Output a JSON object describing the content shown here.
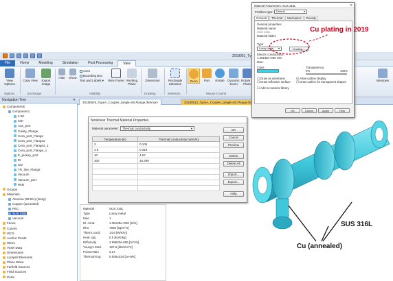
{
  "app": {
    "title": "2018051_TypeA..."
  },
  "ribbon_tabs": [
    "File",
    "Home",
    "Modeling",
    "Simulation",
    "Post Processing",
    "View"
  ],
  "ribbon": {
    "view_options": "View Options",
    "copy_view": "Copy View",
    "export_image": "Export Image",
    "hide": "Hide",
    "show": "Show",
    "axes": "Axes",
    "bounding_box": "Bounding Box",
    "text_labels": "Text and Labels",
    "wire_frame": "Wire Frame",
    "working_plane": "Working Plane",
    "dimension": "Dimension",
    "rectangle_selection": "Rectangle Selection",
    "zoom": "Zoom",
    "pan": "Pan",
    "rotate": "Rotate",
    "dynamic_zoom": "Dynamic Zoom",
    "rotate_in_plane": "Rotate in Plane",
    "windows": "Windows",
    "groups": [
      "Options",
      "Exchange",
      "Visibility",
      "Drawing",
      "Selection",
      "Mouse Control"
    ]
  },
  "nav": {
    "title": "Navigation Tree",
    "items": [
      "Components",
      "component1",
      "4.5K",
      "40K",
      "Aux_port",
      "Cavity_Flange",
      "Cera_port_Flange",
      "Cera_port_Flange2",
      "Cera_port_Flange2_1",
      "Cera_port_Flange_1",
      "E_pickup_port",
      "ID",
      "OD",
      "TR_line_Flange",
      "Vacuum",
      "Vacuum_port",
      "WIN",
      "Groups",
      "Materials",
      "Alumina (99.5%) (lossy)",
      "Copper (annealed)",
      "PEC",
      "SUS 316L",
      "Vacuum",
      "Faces",
      "Curves",
      "WCS",
      "Anchor Points",
      "Wires",
      "Voxel Data",
      "Dimensions",
      "Lumped Elements",
      "Plane Wave",
      "Farfield Sources",
      "Field Sources",
      "Ports"
    ]
  },
  "doc_tabs": [
    "20180629_TypeA_Coupler_(angle=60,Flange,thermal>",
    "20180513_TypeA_Coupler_(angle=60,Flange,thermal>"
  ],
  "nonlinear_dialog": {
    "title": "Nonlinear Thermal Material Properties",
    "param_label": "Material parameter:",
    "param_value": "Thermal conductivity",
    "col1": "Temperature [K]",
    "col2": "Thermal conductivity [W/m/K]",
    "rows": [
      [
        "2",
        "0.105"
      ],
      [
        "4.5",
        "0.319"
      ],
      [
        "40",
        "4.67"
      ],
      [
        "300",
        "15.309"
      ]
    ],
    "buttons": [
      "OK",
      "Cancel",
      "Preview",
      "Delete",
      "Delete All",
      "Import...",
      "Export...",
      "Help"
    ]
  },
  "props": {
    "rows": [
      [
        "Material",
        "SUS 316L"
      ],
      [
        "Type",
        "Lossy metal"
      ],
      [
        "Mue",
        "1"
      ],
      [
        "El. cond.",
        "1.35135e+006 [S/m]"
      ],
      [
        "Rho",
        "7900 [kg/m^3]"
      ],
      [
        "Therm.cond.",
        "14.6 [W/K/m]"
      ],
      [
        "Heat cap.",
        "0.5 [kJ/K/kg]"
      ],
      [
        "Diffusivity",
        "3.69620e-006 [m^2/s]"
      ],
      [
        "Young's Mod.",
        "197.5 [kN/mm^2]"
      ],
      [
        "Poiss.Ratio",
        "0.27"
      ],
      [
        "Thermal Exp.",
        "0.0064234 [1e-6/K]"
      ]
    ]
  },
  "mat_dialog": {
    "title": "Material Parameters: SUS 316L",
    "problem_type_label": "Problem type:",
    "problem_type": "Default",
    "tabs": [
      "General",
      "Thermal",
      "Mechanics",
      "Density"
    ],
    "general_props": "General properties",
    "material_name_label": "Material name:",
    "material_name": "SUS 316L",
    "material_folder_label": "Material folder:",
    "type_label": "Type:",
    "type_value": "Lossy metal",
    "coating_btn": "Coating...",
    "el_cond_label": "Electric conductivity:",
    "el_cond_value": "1.35135e+006",
    "el_cond_unit": "S/m",
    "mue_label": "Mue:",
    "color_label": "Color:",
    "transparency_label": "Transparency:",
    "t0": "0%",
    "t100": "100%",
    "chk_draw_wireframe": "Draw as wireframe",
    "chk_reflective": "Draw reflective surface",
    "chk_outline": "Allow outline display",
    "chk_transparent": "Draw outline for transparent shapes",
    "chk_favorites": "Add to material library",
    "buttons": [
      "OK",
      "Cancel",
      "Apply",
      "Help"
    ]
  },
  "annotations": {
    "cu_plating": "Cu plating in 2019",
    "sus": "SUS 316L",
    "cu_annealed": "Cu (annealed)"
  },
  "colors": {
    "accent": "#2e6db6",
    "red": "#d0021b",
    "cyan": "#3fd0e4"
  }
}
